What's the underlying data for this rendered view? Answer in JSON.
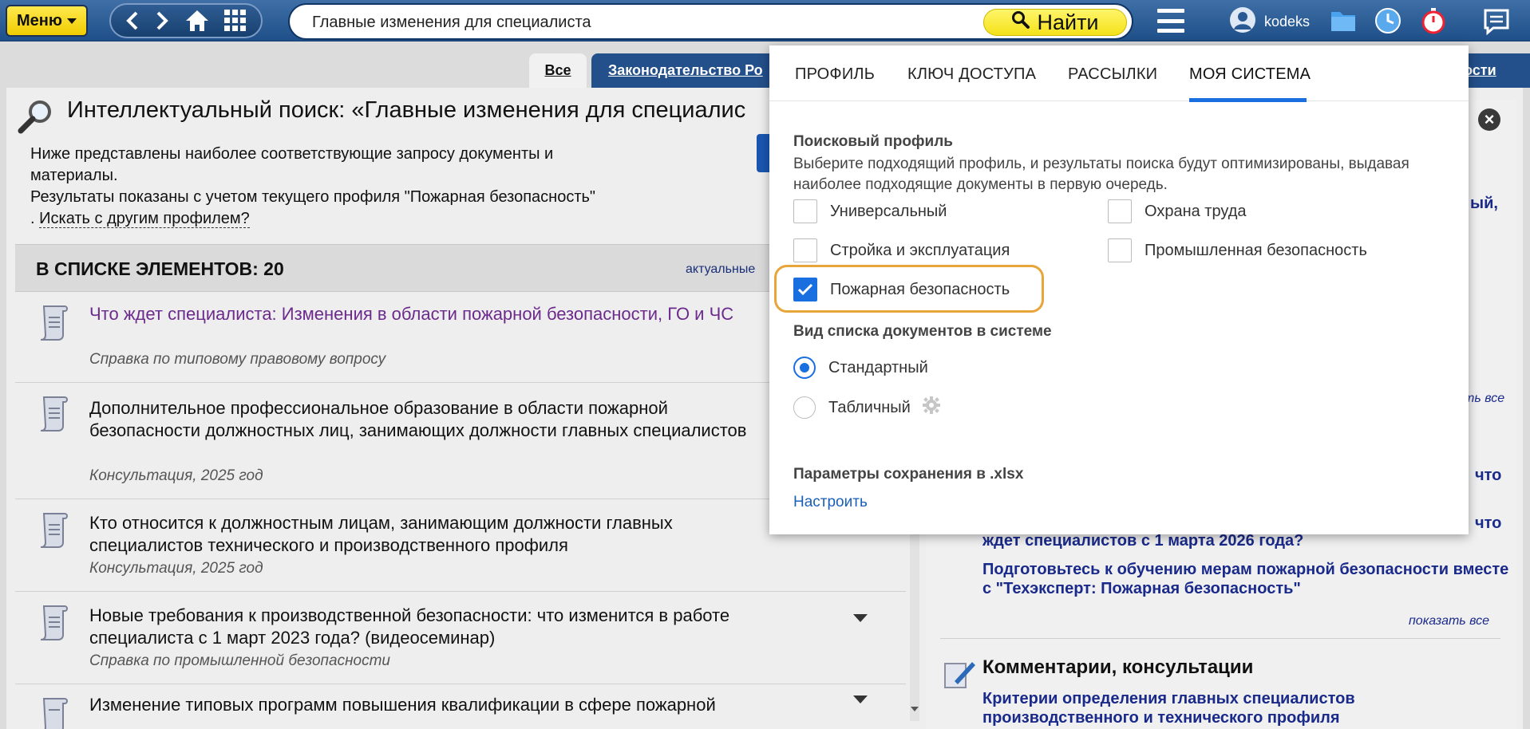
{
  "topbar": {
    "menu_label": "Меню",
    "search_value": "Главные изменения для специалиста",
    "find_label": "Найти",
    "username": "kodeks"
  },
  "tabs": {
    "all": "Все",
    "law": "Законодательство Ро",
    "right": "ости"
  },
  "main": {
    "title": "Интеллектуальный поиск: «Главные изменения для специалис",
    "intro_line1": "Ниже представлены наиболее соответствующие запросу документы и",
    "intro_line2": "материалы.",
    "intro_line3": "Результаты показаны с учетом текущего профиля \"Пожарная безопасность\"",
    "intro_prefix": ".",
    "intro_link": "Искать с другим профилем?",
    "list_count": "В СПИСКЕ ЭЛЕМЕНТОВ: 20",
    "list_filter": "актуальные"
  },
  "documents": [
    {
      "title": "Что ждет специалиста: Изменения в области пожарной безопасности, ГО и ЧС",
      "subtitle": "Справка по типовому правовому вопросу"
    },
    {
      "title": "Дополнительное профессиональное образование в области пожарной безопасности должностных лиц, занимающих должности главных специалистов",
      "subtitle": "Консультация, 2025 год"
    },
    {
      "title": "Кто относится к должностным лицам, занимающим должности главных специалистов технического и производственного профиля",
      "subtitle": "Консультация, 2025 год"
    },
    {
      "title": "Новые требования к производственной безопасности: что изменится в работе специалиста с 1 март 2023 года? (видеосеминар)",
      "subtitle": "Справка по промышленной безопасности"
    },
    {
      "title": "Изменение типовых программ повышения квалификации в сфере пожарной",
      "subtitle": ""
    }
  ],
  "right_pane": {
    "frag1": "ый,",
    "show_all_1": "ть все",
    "frag2": "что",
    "frag3": "что",
    "link1_line2": "ждет специалистов с 1 марта 2026 года?",
    "link2": "Подготовьтесь к обучению мерам пожарной безопасности вместе с \"Техэксперт: Пожарная безопасность\"",
    "show_all_2": "показать все",
    "comments_heading": "Комментарии, консультации",
    "comment_link": "Критерии определения главных специалистов производственного и технического профиля"
  },
  "panel": {
    "tabs": [
      "ПРОФИЛЬ",
      "КЛЮЧ ДОСТУПА",
      "РАССЫЛКИ",
      "МОЯ СИСТЕМА"
    ],
    "active_tab": "МОЯ СИСТЕМА",
    "search_profile_title": "Поисковый профиль",
    "search_profile_desc": "Выберите подходящий профиль, и результаты поиска будут оптимизированы, выдавая наиболее подходящие документы в первую очередь.",
    "profiles": [
      {
        "label": "Универсальный",
        "checked": false
      },
      {
        "label": "Охрана труда",
        "checked": false
      },
      {
        "label": "Стройка и эксплуатация",
        "checked": false
      },
      {
        "label": "Промышленная безопасность",
        "checked": false
      },
      {
        "label": "Пожарная безопасность",
        "checked": true
      }
    ],
    "list_view_title": "Вид списка документов в системе",
    "list_views": [
      {
        "label": "Стандартный",
        "selected": true
      },
      {
        "label": "Табличный",
        "selected": false
      }
    ],
    "xlsx_title": "Параметры сохранения в .xlsx",
    "configure_link": "Настроить"
  },
  "colors": {
    "accent": "#1a6fe0",
    "topbar": "#2a5a94",
    "highlight": "#e8a53a",
    "menu_yellow": "#f6d80b"
  }
}
